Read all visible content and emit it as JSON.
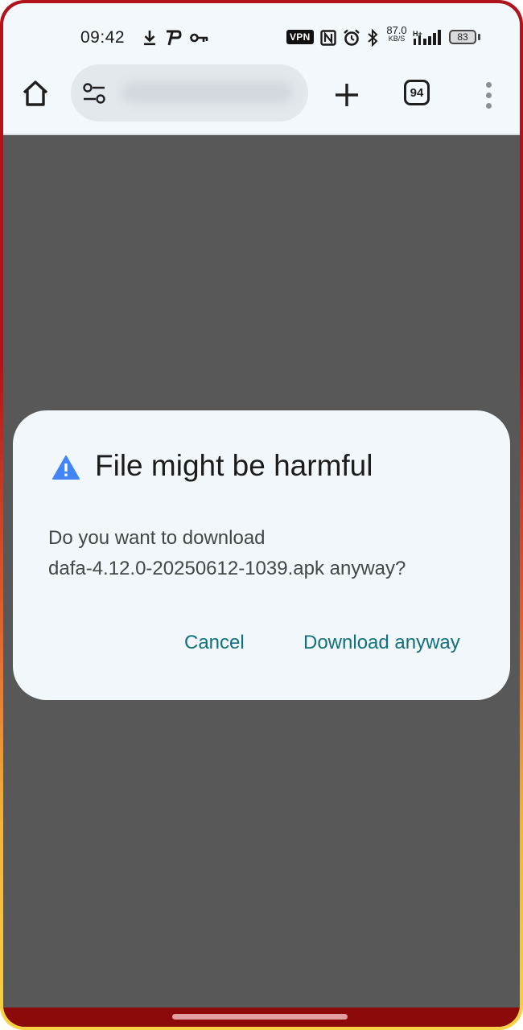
{
  "status_bar": {
    "time": "09:42",
    "vpn_label": "VPN",
    "net_speed_value": "87.0",
    "net_speed_unit": "KB/S",
    "network_type": "H+",
    "battery_level": "83",
    "icons": [
      "download-icon",
      "p-app-icon",
      "key-icon",
      "nfc-icon",
      "alarm-icon",
      "bluetooth-icon",
      "signal-icon"
    ]
  },
  "toolbar": {
    "url": "",
    "tab_count": "94",
    "icons": [
      "home-icon",
      "tune-icon",
      "plus-icon",
      "more-vert-icon"
    ]
  },
  "dialog": {
    "title": "File might be harmful",
    "message_line1": "Do you want to download",
    "message_line2": "dafa-4.12.0-20250612-1039.apk anyway?",
    "cancel_label": "Cancel",
    "confirm_label": "Download anyway",
    "warning_icon": "warning-icon",
    "accent_color": "#11707d",
    "warning_color": "#4285f4"
  },
  "colors": {
    "scrim": "#585858",
    "chrome_bg": "#f3f8fc",
    "dialog_bg": "#f1f7fb"
  }
}
